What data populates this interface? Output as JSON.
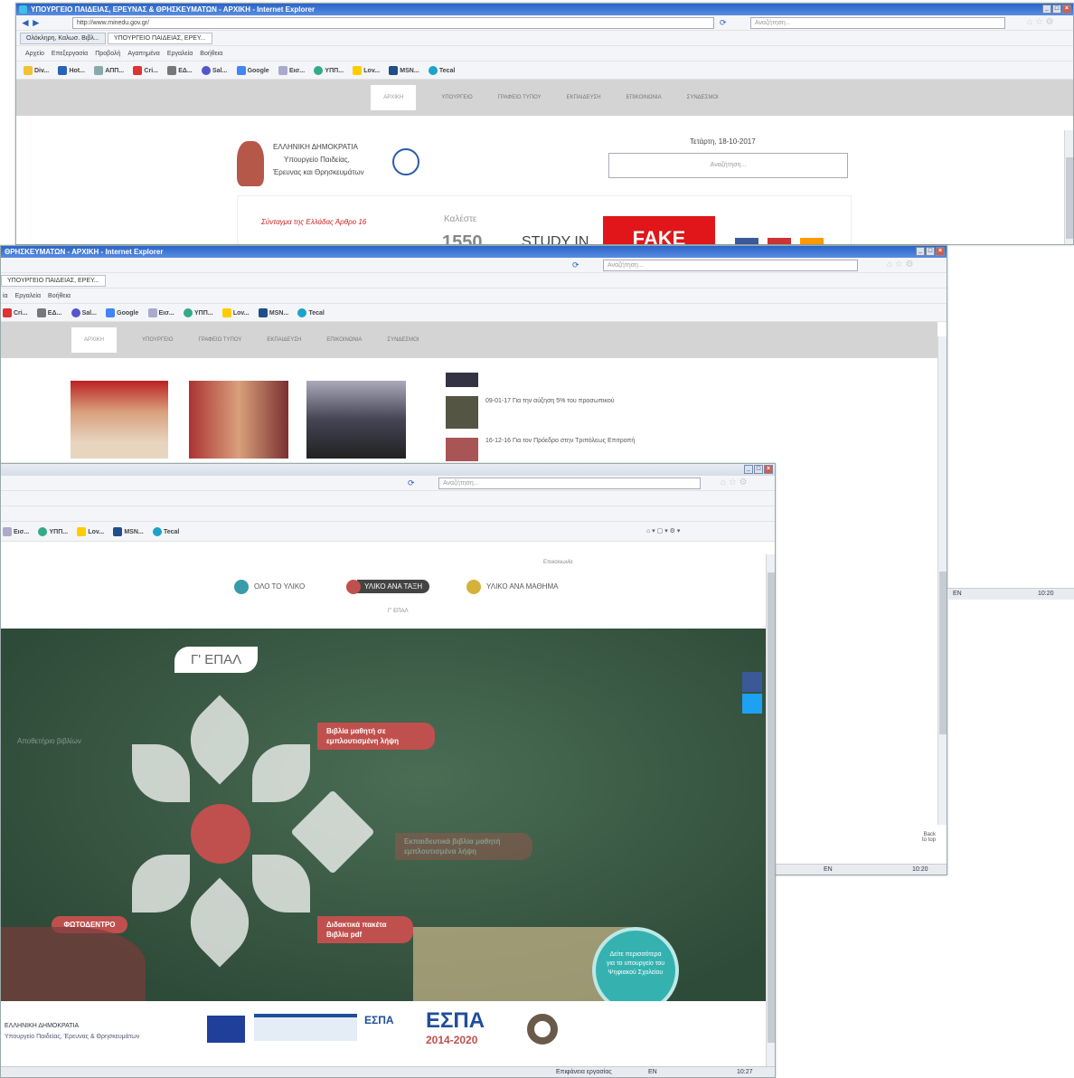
{
  "w1": {
    "title": "ΥΠΟΥΡΓΕΙΟ ΠΑΙΔΕΙΑΣ, ΕΡΕΥΝΑΣ & ΘΡΗΣΚΕΥΜΑΤΩΝ - ΑΡΧΙΚΗ - Internet Explorer",
    "url": "http://www.minedu.gov.gr/",
    "search": "Αναζήτηση...",
    "tab1": "Ολόκληρη, Καλωσ. Βιβλ...",
    "tab2": "ΥΠΟΥΡΓΕΙΟ ΠΑΙΔΕΙΑΣ, ΕΡΕΥ...",
    "date": "Τετάρτη, 18-10-2017",
    "site_search": "Αναζήτηση...",
    "logo_line1": "ΕΛΛΗΝΙΚΗ ΔΗΜΟΚΡΑΤΙΑ",
    "logo_line2": "Υπουργείο Παιδείας,",
    "logo_line3": "Έρευνας και Θρησκευμάτων",
    "banner_text": "Σύνταγμα της Ελλάδας Άρθρο 16",
    "hotline_label": "Καλέστε",
    "hotline_num": "1550",
    "studyin": "STUDY IN",
    "fake": "FAKE"
  },
  "menu": [
    "Αρχείο",
    "Επεξεργασία",
    "Προβολή",
    "Αγαπημένα",
    "Εργαλεία",
    "Βοήθεια"
  ],
  "favorites": [
    "Div...",
    "Hot...",
    "ΑΠΠ...",
    "Cri...",
    "ΕΔ...",
    "Sal...",
    "Google",
    "Εισ...",
    "ΥΠΠ...",
    "Lov...",
    "MSN...",
    "Tecal"
  ],
  "nav": [
    "ΑΡΧΙΚΗ",
    "ΥΠΟΥΡΓΕΙΟ",
    "ΓΡΑΦΕΙΟ ΤΥΠΟΥ",
    "ΕΚΠΑΙΔΕΥΣΗ",
    "ΕΠΙΚΟΙΝΩΝΙΑ",
    "ΣΥΝΔΕΣΜΟΙ"
  ],
  "w2": {
    "title": "ΘΡΗΣΚΕΥΜΑΤΩΝ - ΑΡΧΙΚΗ - Internet Explorer",
    "search": "Αναζήτηση...",
    "tab": "ΥΠΟΥΡΓΕΙΟ ΠΑΙΔΕΙΑΣ, ΕΡΕΥ...",
    "menu": [
      "ία",
      "Εργαλεία",
      "Βοήθεια"
    ],
    "favs": [
      "Cri...",
      "ΕΔ...",
      "Sal...",
      "Google",
      "Εισ...",
      "ΥΠΠ...",
      "Lov...",
      "MSN...",
      "Tecal"
    ],
    "news1": "09-01-17 Για την αύξηση 5% του προσωπικού",
    "news2": "16-12-16 Για τον Πρόεδρο στην Τριπόλεως Επιτροπή",
    "status": "EN",
    "time": "10:20",
    "back": "Back",
    "totop": "to top"
  },
  "w3": {
    "search": "Αναζήτηση...",
    "favs": [
      "Εισ...",
      "ΥΠΠ...",
      "Lov...",
      "MSN...",
      "Tecal"
    ],
    "top_link": "Επικοινωνία",
    "opt1": "ΟΛΟ ΤΟ ΥΛΙΚΟ",
    "opt2": "ΥΛΙΚΟ ΑΝΑ ΤΑΞΗ",
    "opt3": "ΥΛΙΚΟ ΑΝΑ ΜΑΘΗΜΑ",
    "sub": "Γ' ΕΠΑΛ",
    "grade": "Γ' ΕΠΑΛ",
    "pill1": "Βιβλία μαθητή σε εμπλουτισμένη λήψη",
    "pill2": "Εκπαιδευτικά βιβλία μαθητή εμπλουτισμένα λήψη",
    "pill3": "Διδακτικά πακέτα Βιβλία pdf",
    "pill4": "ΦΩΤΟΔΕΝΤΡΟ",
    "left_text": "Αποθετήριο βιβλίων",
    "circle": "Δείτε περισσότερα για το υπουργείο του Ψηφιακού Σχολείου",
    "footer1": "ΕΛΛΗΝΙΚΗ ΔΗΜΟΚΡΑΤΙΑ",
    "footer2": "Υπουργείο Παιδείας, Έρευνας & Θρησκευμάτων",
    "espa1": "ΕΣΠΑ",
    "espa2": "ΕΣΠΑ",
    "espa_years": "2014-2020",
    "status_zone": "Επιφάνεια εργασίας",
    "status_lang": "EN",
    "status_time": "10:27"
  }
}
